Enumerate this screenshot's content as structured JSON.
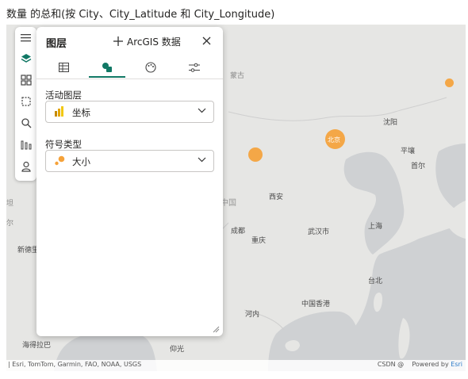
{
  "title": "数量 的总和(按 City、City_Latitude 和 City_Longitude)",
  "panel": {
    "title": "图层",
    "add_data_label": "ArcGIS 数据",
    "active_layer_label": "活动图层",
    "active_layer_value": "坐标",
    "symbol_type_label": "符号类型",
    "symbol_type_value": "大小"
  },
  "map_labels": {
    "moscow": "蒙古",
    "beijing": "北京",
    "shenyang": "沈阳",
    "pyongyang": "平壤",
    "seoul": "首尔",
    "xian": "西安",
    "china": "中国",
    "chengdu": "成都",
    "chongqing": "重庆",
    "wuhan": "武汉市",
    "shanghai": "上海",
    "newdelhi": "新德里",
    "taipei": "台北",
    "hongkong": "中国香港",
    "hanoi": "河内",
    "hyderabad": "海得拉巴",
    "yangon": "仰光",
    "left_edge_1": "坦",
    "left_edge_2": "尔"
  },
  "attribution": {
    "left": "| Esri, TomTom, Garmin, FAO, NOAA, USGS",
    "powered_by": "Powered by",
    "esri": "Esri",
    "watermark": "CSDN @"
  },
  "colors": {
    "bubble": "#f5a23a",
    "accent": "#117865",
    "land": "#e6e6e4",
    "water": "#cfd1d3"
  },
  "icons": {
    "menu": "hamburger-icon",
    "layers": "layers-icon",
    "basemap": "grid-icon",
    "select": "lasso-select-icon",
    "search": "search-icon",
    "chart": "bars-icon",
    "user": "person-icon"
  }
}
